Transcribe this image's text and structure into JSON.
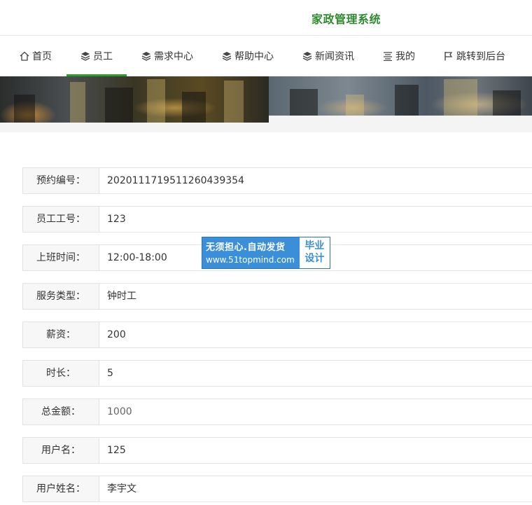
{
  "header": {
    "title": "家政管理系统"
  },
  "nav": {
    "items": [
      {
        "label": "首页",
        "icon": "home-icon"
      },
      {
        "label": "员工",
        "icon": "layers-icon",
        "active": true
      },
      {
        "label": "需求中心",
        "icon": "layers-icon"
      },
      {
        "label": "帮助中心",
        "icon": "layers-icon"
      },
      {
        "label": "新闻资讯",
        "icon": "layers-icon"
      },
      {
        "label": "我的",
        "icon": "menu-icon"
      },
      {
        "label": "跳转到后台",
        "icon": "flag-icon"
      }
    ],
    "active_color": "#2e9d2e"
  },
  "form": {
    "rows": [
      {
        "label": "预约编号：",
        "value": "20201117195112604393​54"
      },
      {
        "label": "员工工号：",
        "value": "123"
      },
      {
        "label": "上班时间：",
        "value": "12:00-18:00"
      },
      {
        "label": "服务类型：",
        "value": "钟时工"
      },
      {
        "label": "薪资：",
        "value": "200"
      },
      {
        "label": "时长：",
        "value": "5"
      },
      {
        "label": "总金额：",
        "value": "1000"
      },
      {
        "label": "用户名：",
        "value": "125"
      },
      {
        "label": "用户姓名：",
        "value": "李宇文"
      }
    ]
  },
  "watermark": {
    "line1": "无须担心.自动发货",
    "line2": "www.51topmind.com",
    "badge_line1": "毕业",
    "badge_line2": "设计"
  },
  "colors": {
    "brand": "#2e8b2e",
    "watermark": "#3a8fd8"
  }
}
